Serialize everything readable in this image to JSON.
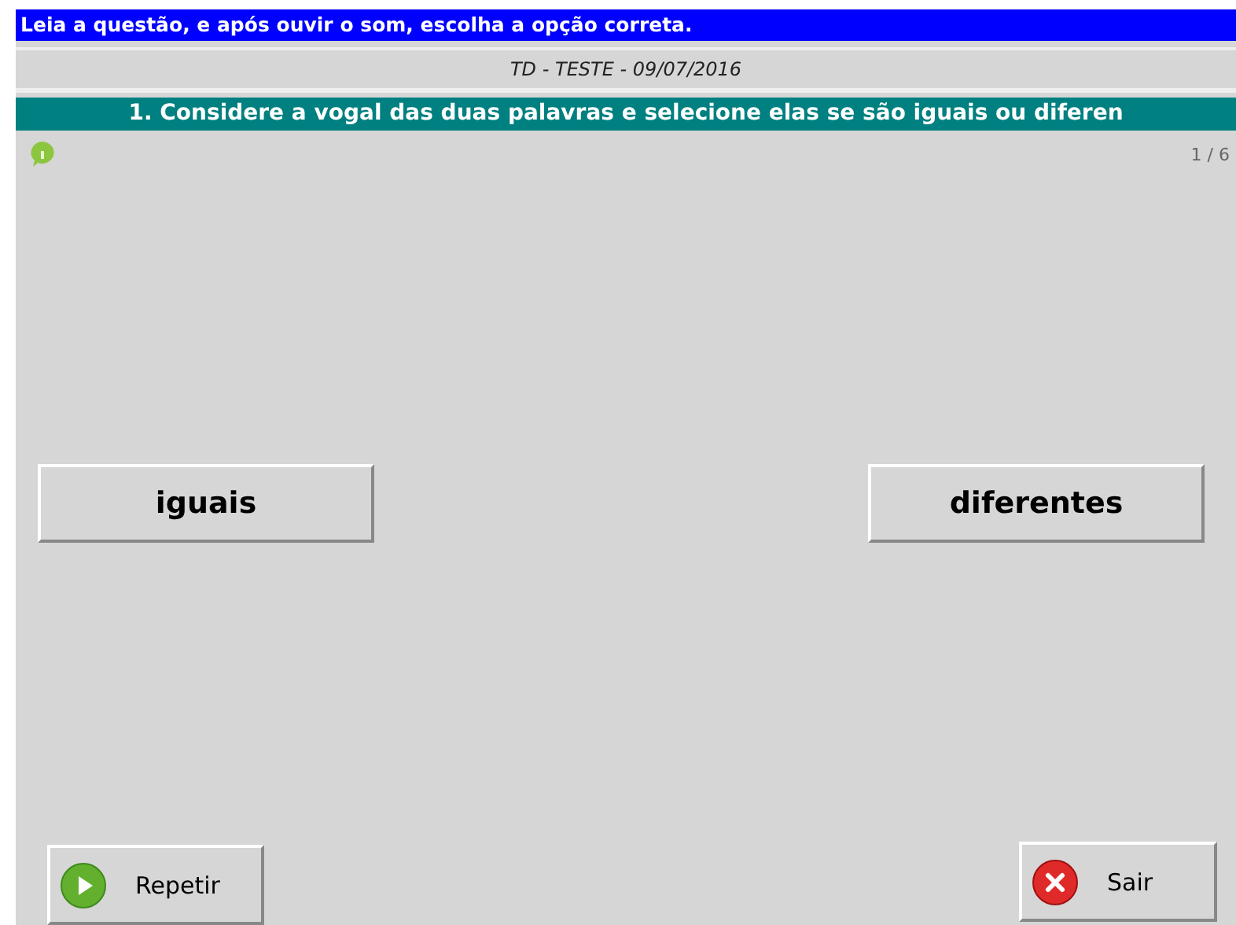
{
  "instruction": "Leia a questão, e após ouvir o som, escolha a opção correta.",
  "test_title": "TD - TESTE - 09/07/2016",
  "question": "1. Considere a vogal das duas palavras e selecione elas se são iguais ou diferen",
  "progress": "1 / 6",
  "options": [
    {
      "label": "iguais"
    },
    {
      "label": "diferentes"
    }
  ],
  "footer_buttons": [
    {
      "kind": "play",
      "label": "Repetir"
    },
    {
      "kind": "close",
      "label": "Sair"
    }
  ]
}
